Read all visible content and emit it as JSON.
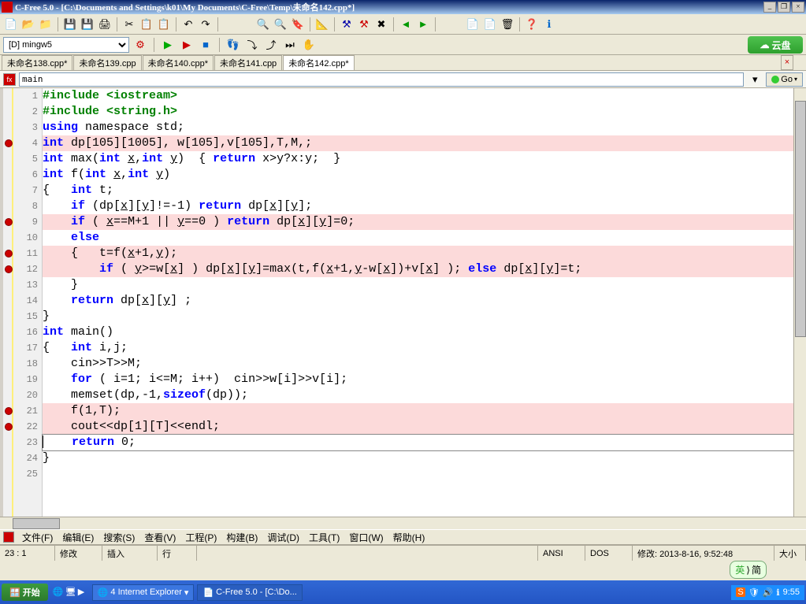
{
  "title": "C-Free 5.0 - [C:\\Documents and Settings\\k01\\My Documents\\C-Free\\Temp\\未命名142.cpp*]",
  "compiler_combo": "[D] mingw5",
  "yunpan": "云盘",
  "tabs": [
    {
      "label": "未命名138.cpp*"
    },
    {
      "label": "未命名139.cpp"
    },
    {
      "label": "未命名140.cpp*"
    },
    {
      "label": "未命名141.cpp"
    },
    {
      "label": "未命名142.cpp*"
    }
  ],
  "fn_input": "main",
  "go_label": "Go",
  "code": {
    "l1": "#include <iostream>",
    "l2": "#include <string.h>",
    "l3_a": "using",
    "l3_b": " namespace std;",
    "l4_a": "int",
    "l4_b": " dp[105][1005], w[105],v[105],T,M,;",
    "l5_a": "int",
    "l5_b": " max(",
    "l5_c": "int",
    "l5_d": " ",
    "l5_x": "x",
    "l5_e": ",",
    "l5_f": "int",
    "l5_g": " ",
    "l5_y": "y",
    "l5_h": ")  { ",
    "l5_i": "return",
    "l5_j": " x>y?x:y;  }",
    "l6_a": "int",
    "l6_b": " f(",
    "l6_c": "int",
    "l6_d": " ",
    "l6_x": "x",
    "l6_e": ",",
    "l6_f": "int",
    "l6_g": " ",
    "l6_y": "y",
    "l6_h": ")",
    "l7_a": "{   ",
    "l7_b": "int",
    "l7_c": " t;",
    "l8_a": "    ",
    "l8_b": "if",
    "l8_c": " (dp[",
    "l8_x": "x",
    "l8_d": "][",
    "l8_y": "y",
    "l8_e": "]!=-1) ",
    "l8_f": "return",
    "l8_g": " dp[",
    "l8_x2": "x",
    "l8_h": "][",
    "l8_y2": "y",
    "l8_i": "];",
    "l9_a": "    ",
    "l9_b": "if",
    "l9_c": " ( ",
    "l9_x": "x",
    "l9_d": "==M+1 || ",
    "l9_y": "y",
    "l9_e": "==0 ) ",
    "l9_f": "return",
    "l9_g": " dp[",
    "l9_x2": "x",
    "l9_h": "][",
    "l9_y2": "y",
    "l9_i": "]=0;",
    "l10_a": "    ",
    "l10_b": "else",
    "l11_a": "    {   t=f(",
    "l11_x": "x",
    "l11_b": "+1,",
    "l11_y": "y",
    "l11_c": ");",
    "l12_a": "        ",
    "l12_b": "if",
    "l12_c": " ( ",
    "l12_y": "y",
    "l12_d": ">=w[",
    "l12_x": "x",
    "l12_e": "] ) dp[",
    "l12_x2": "x",
    "l12_f": "][",
    "l12_y2": "y",
    "l12_g": "]=max(t,f(",
    "l12_x3": "x",
    "l12_h": "+1,",
    "l12_y3": "y",
    "l12_i": "-w[",
    "l12_x4": "x",
    "l12_j": "])+v[",
    "l12_x5": "x",
    "l12_k": "] ); ",
    "l12_l": "else",
    "l12_m": " dp[",
    "l12_x6": "x",
    "l12_n": "][",
    "l12_y4": "y",
    "l12_o": "]=t;",
    "l13": "    }",
    "l14_a": "    ",
    "l14_b": "return",
    "l14_c": " dp[",
    "l14_x": "x",
    "l14_d": "][",
    "l14_y": "y",
    "l14_e": "] ;",
    "l15": "}",
    "l16_a": "int",
    "l16_b": " main()",
    "l17_a": "{   ",
    "l17_b": "int",
    "l17_c": " i,j;",
    "l18": "    cin>>T>>M;",
    "l19_a": "    ",
    "l19_b": "for",
    "l19_c": " ( i=1; i<=M; i++)  cin>>w[i]>>v[i];",
    "l20_a": "    memset(dp,-1,",
    "l20_b": "sizeof",
    "l20_c": "(dp));",
    "l21": "    f(1,T);",
    "l22": "    cout<<dp[1][T]<<endl;",
    "l23_a": "    ",
    "l23_b": "return",
    "l23_c": " 0;",
    "l24": "}",
    "l25": ""
  },
  "lineno": {
    "n1": "1",
    "n2": "2",
    "n3": "3",
    "n4": "4",
    "n5": "5",
    "n6": "6",
    "n7": "7",
    "n8": "8",
    "n9": "9",
    "n10": "10",
    "n11": "11",
    "n12": "12",
    "n13": "13",
    "n14": "14",
    "n15": "15",
    "n16": "16",
    "n17": "17",
    "n18": "18",
    "n19": "19",
    "n20": "20",
    "n21": "21",
    "n22": "22",
    "n23": "23",
    "n24": "24",
    "n25": "25"
  },
  "menu": {
    "file": "文件(F)",
    "edit": "编辑(E)",
    "search": "搜索(S)",
    "view": "查看(V)",
    "project": "工程(P)",
    "build": "构建(B)",
    "debug": "调试(D)",
    "tools": "工具(T)",
    "window": "窗口(W)",
    "help": "帮助(H)"
  },
  "status": {
    "pos": "23 :  1",
    "modify": "修改",
    "insert": "插入",
    "row": "行",
    "encoding": "ANSI",
    "os": "DOS",
    "modified": "修改: 2013-8-16, 9:52:48",
    "size": "大小"
  },
  "taskbar": {
    "start": "开始",
    "task1": "4 Internet Explorer",
    "task2": "C-Free 5.0 - [C:\\Do...",
    "ime": "英",
    "ime2": "简",
    "clock": "9:55"
  }
}
